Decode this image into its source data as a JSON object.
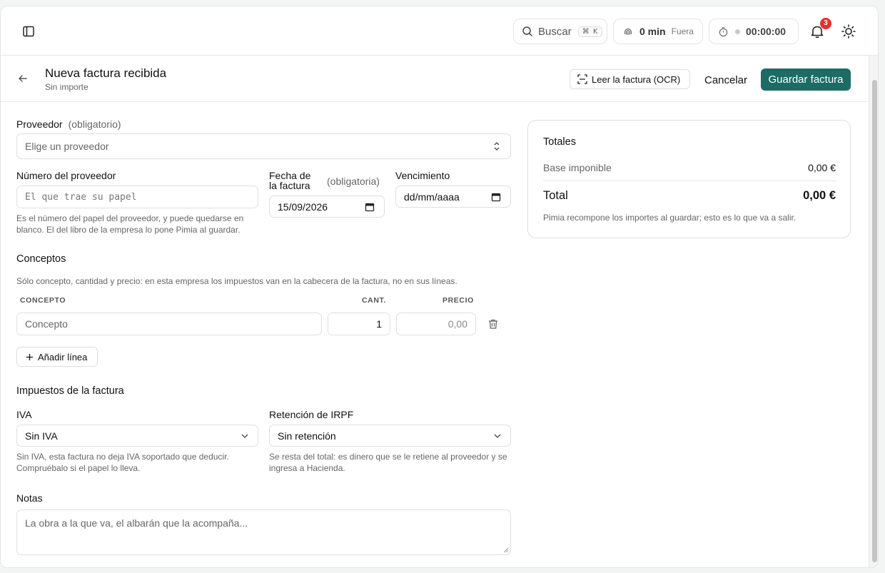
{
  "topbar": {
    "search": {
      "label": "Buscar",
      "shortcut": "⌘ K"
    },
    "time_tracker": {
      "value": "0 min",
      "status": "Fuera"
    },
    "timer": {
      "value": "00:00:00"
    },
    "notifications": {
      "count": "3"
    }
  },
  "header": {
    "title": "Nueva factura recibida",
    "subtitle": "Sin importe",
    "ocr_label": "Leer la factura (OCR)",
    "cancel_label": "Cancelar",
    "save_label": "Guardar factura"
  },
  "form": {
    "supplier": {
      "label": "Proveedor",
      "required": "(obligatorio)",
      "placeholder": "Elige un proveedor"
    },
    "supplier_number": {
      "label": "Número del proveedor",
      "placeholder": "El que trae su papel",
      "help": "Es el número del papel del proveedor, y puede quedarse en blanco. El del libro de la empresa lo pone Pimia al guardar."
    },
    "invoice_date": {
      "label_line1": "Fecha de",
      "label_line2": "la factura",
      "required": "(obligatoria)",
      "value": "15/09/2026"
    },
    "due_date": {
      "label": "Vencimiento",
      "placeholder": "dd/mm/aaaa"
    },
    "concepts": {
      "title": "Conceptos",
      "help": "Sólo concepto, cantidad y precio: en esta empresa los impuestos van en la cabecera de la factura, no en sus líneas.",
      "columns": {
        "concept": "CONCEPTO",
        "qty": "CANT.",
        "price": "PRECIO"
      },
      "rows": [
        {
          "concept_placeholder": "Concepto",
          "qty": "1",
          "price_placeholder": "0,00"
        }
      ],
      "add_label": "Añadir línea"
    },
    "taxes": {
      "title": "Impuestos de la factura",
      "iva": {
        "label": "IVA",
        "value": "Sin IVA",
        "help": "Sin IVA, esta factura no deja IVA soportado que deducir. Compruébalo si el papel lo lleva."
      },
      "irpf": {
        "label": "Retención de IRPF",
        "value": "Sin retención",
        "help": "Se resta del total: es dinero que se le retiene al proveedor y se ingresa a Hacienda."
      }
    },
    "notes": {
      "label": "Notas",
      "placeholder": "La obra a la que va, el albarán que la acompaña..."
    }
  },
  "totals": {
    "title": "Totales",
    "base_label": "Base imponible",
    "base_value": "0,00 €",
    "total_label": "Total",
    "total_value": "0,00 €",
    "note": "Pimia recompone los importes al guardar; esto es lo que va a salir."
  },
  "colors": {
    "primary": "#1c6b64",
    "badge": "#e5302c"
  }
}
